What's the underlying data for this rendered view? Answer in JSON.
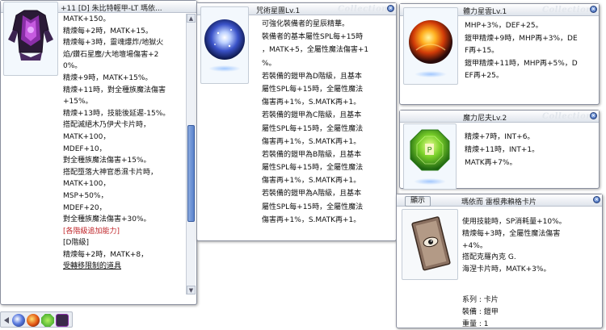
{
  "colors": {
    "accent": "#3860b0",
    "red": "#c0282c"
  },
  "win1": {
    "title": "+11 [D] 朱比特輕甲-LT 瑪依...",
    "icon": "purple-armor-icon",
    "lines": [
      "MATK+150。",
      "精煉每+2時，MATK+15。",
      "精煉每+3時，靈魂爆炸/地獄火",
      "焰/鑽石星塵/大地壇場傷害+2",
      "0%。",
      "精煉+9時，MATK+15%。",
      "精煉+11時，對全種族魔法傷害",
      "+15%。",
      "精煉+13時，技能後延遲-15%。",
      "搭配滅絕木乃伊犬卡片時，",
      "MATK+100，",
      "MDEF+10，",
      "對全種族魔法傷害+15%。",
      "搭配墮落大神官悉濕卡片時，",
      "MATK+100，",
      "MSP+50%，",
      "MDEF+20，",
      "對全種族魔法傷害+30%。",
      "[各階級追加能力]",
      "[D階級]",
      "精煉每+2時，MATK+8，",
      "受轉移限制的道具"
    ],
    "scroll_fraction": 0.62
  },
  "win2": {
    "title": "咒術星團Lv.1",
    "watermark": "Collections",
    "icon": "star-cluster-orb-icon",
    "lines": [
      "可強化裝備者的星辰精華。",
      "裝備者的基本屬性SPL每+15時",
      "，MATK+5，全屬性魔法傷害+1",
      "%。",
      "若裝備的鎧甲為D階級，且基本",
      "屬性SPL每+15時，全屬性魔法",
      "傷害再+1%，S.MATK再+1。",
      "若裝備的鎧甲為C階級，且基本",
      "屬性SPL每+15時，全屬性魔法",
      "傷害再+1%，S.MATK再+1。",
      "若裝備的鎧甲為B階級，且基本",
      "屬性SPL每+15時，全屬性魔法",
      "傷害再+1%，S.MATK再+1。",
      "若裝備的鎧甲為A階級，且基本",
      "屬性SPL每+15時，全屬性魔法",
      "傷害再+1%，S.MATK再+1。"
    ]
  },
  "win3": {
    "title": "體力星雲Lv.1",
    "watermark": "Collections",
    "icon": "fire-nebula-orb-icon",
    "lines": [
      "MHP+3%，DEF+25。",
      "鎧甲精煉+9時，MHP再+3%，DE",
      "F再+15。",
      "鎧甲精煉+11時，MHP再+5%，D",
      "EF再+25。"
    ]
  },
  "win4": {
    "title": "魔力尼夫Lv.2",
    "watermark": "Collections",
    "icon": "green-gem-icon",
    "lines": [
      "精煉+7時，INT+6。",
      "精煉+11時，INT+1。",
      "MATK再+7%。"
    ]
  },
  "win5": {
    "title": "瑪依而 雷根弗賴格卡片",
    "tag": "顯示",
    "icon": "card-eye-icon",
    "lines": [
      "使用技能時，SP消耗量+10%。",
      "精煉每+3時，全屬性魔法傷害",
      "+4%。",
      "搭配克羅內克 G.",
      "海涅卡片時，MATK+3%。"
    ],
    "props": [
      {
        "k": "系列",
        "v": "卡片"
      },
      {
        "k": "裝備",
        "v": "鎧甲"
      },
      {
        "k": "重量",
        "v": "1"
      }
    ]
  }
}
